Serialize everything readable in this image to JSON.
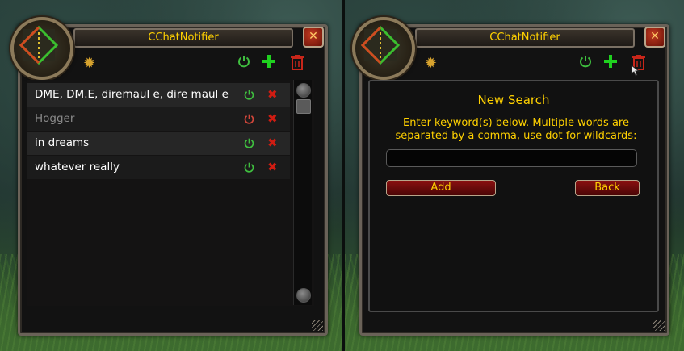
{
  "left": {
    "title": "CChatNotifier",
    "close_label": "✕",
    "rows": [
      {
        "label": "DME, DM.E, diremaul e, dire maul e",
        "enabled": true
      },
      {
        "label": "Hogger",
        "enabled": false
      },
      {
        "label": "in dreams",
        "enabled": true
      },
      {
        "label": "whatever really",
        "enabled": true
      }
    ]
  },
  "right": {
    "title": "CChatNotifier",
    "close_label": "✕",
    "panel_title": "New Search",
    "panel_description": "Enter keyword(s) below. Multiple words are separated by a comma, use dot for wildcards:",
    "input_value": "",
    "add_label": "Add",
    "back_label": "Back"
  },
  "icons": {
    "settings": "gear-icon",
    "toggle": "power-icon",
    "add": "plus-icon",
    "delete_all": "trash-icon",
    "delete_row": "x-icon"
  },
  "colors": {
    "title_text": "#ffd100",
    "enabled_power": "#3fbf3f",
    "disabled_power": "#d0463a",
    "delete": "#d01c12",
    "add": "#1fd11f"
  }
}
